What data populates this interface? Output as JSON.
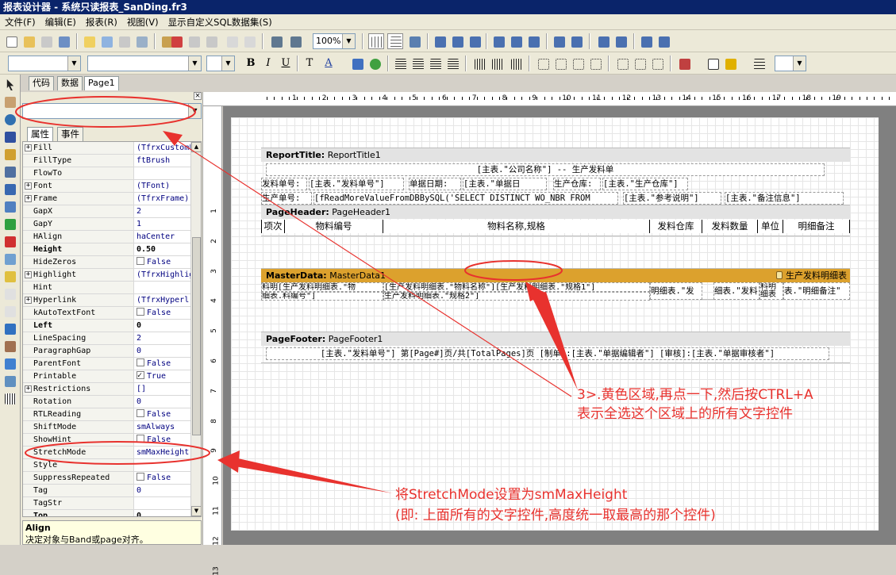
{
  "window": {
    "title": "报表设计器 - 系统只读报表_SanDing.fr3"
  },
  "menu": [
    "文件(F)",
    "编辑(E)",
    "报表(R)",
    "视图(V)",
    "显示自定义SQL数据集(S)"
  ],
  "toolbar": {
    "zoom": "100%"
  },
  "left_tabs": [
    "代码",
    "数据",
    "Page1"
  ],
  "inspector": {
    "object_combo": "",
    "tabs": [
      "属性",
      "事件"
    ],
    "properties": [
      {
        "name": "Fill",
        "value": "(TfrxCustomF",
        "expand": true
      },
      {
        "name": "FillType",
        "value": "ftBrush"
      },
      {
        "name": "FlowTo",
        "value": ""
      },
      {
        "name": "Font",
        "value": "(TFont)",
        "expand": true
      },
      {
        "name": "Frame",
        "value": "(TfrxFrame)",
        "expand": true
      },
      {
        "name": "GapX",
        "value": "2"
      },
      {
        "name": "GapY",
        "value": "1"
      },
      {
        "name": "HAlign",
        "value": "haCenter"
      },
      {
        "name": "Height",
        "value": "0.50",
        "bold": true
      },
      {
        "name": "HideZeros",
        "value": "False",
        "check": false
      },
      {
        "name": "Highlight",
        "value": "(TfrxHighlig",
        "expand": true
      },
      {
        "name": "Hint",
        "value": ""
      },
      {
        "name": "Hyperlink",
        "value": "(TfrxHyperl:",
        "expand": true
      },
      {
        "name": "kAutoTextFont",
        "value": "False",
        "check": false
      },
      {
        "name": "Left",
        "value": "0",
        "bold": true
      },
      {
        "name": "LineSpacing",
        "value": "2"
      },
      {
        "name": "ParagraphGap",
        "value": "0"
      },
      {
        "name": "ParentFont",
        "value": "False",
        "check": false
      },
      {
        "name": "Printable",
        "value": "True",
        "check": true
      },
      {
        "name": "Restrictions",
        "value": "[]",
        "expand": true
      },
      {
        "name": "Rotation",
        "value": "0"
      },
      {
        "name": "RTLReading",
        "value": "False",
        "check": false
      },
      {
        "name": "ShiftMode",
        "value": "smAlways"
      },
      {
        "name": "ShowHint",
        "value": "False",
        "check": false
      },
      {
        "name": "StretchMode",
        "value": "smMaxHeight"
      },
      {
        "name": "Style",
        "value": ""
      },
      {
        "name": "SuppressRepeated",
        "value": "False",
        "check": false
      },
      {
        "name": "Tag",
        "value": "0"
      },
      {
        "name": "TagStr",
        "value": ""
      },
      {
        "name": "Top",
        "value": "0",
        "bold": true
      }
    ],
    "help_title": "Align",
    "help_text": "决定对象与Band或page对齐。"
  },
  "ruler_h": [
    "1",
    "2",
    "3",
    "4",
    "5",
    "6",
    "7",
    "8",
    "9",
    "10",
    "11",
    "12",
    "13",
    "14",
    "15",
    "16",
    "17",
    "18",
    "19"
  ],
  "ruler_v": [
    "1",
    "2",
    "3",
    "4",
    "5",
    "6",
    "7",
    "8",
    "9",
    "10",
    "11",
    "12",
    "13"
  ],
  "bands": {
    "report_title": {
      "label": "ReportTitle:",
      "name": "ReportTitle1",
      "line1": "[主表.\"公司名称\"] -- 生产发料单",
      "line2": [
        "发料单号:",
        "[主表.\"发料单号\"]",
        "单据日期:",
        "[主表.\"单据日",
        "生产仓库:",
        "[主表.\"生产仓库\"]"
      ],
      "line3": [
        "生产单号:",
        "[fReadMoreValueFromDBBySQL('SELECT DISTINCT WO_NBR FROM",
        "[主表.\"参考说明\"]",
        "[主表.\"备注信息\"]"
      ]
    },
    "page_header": {
      "label": "PageHeader:",
      "name": "PageHeader1",
      "columns": [
        "项次",
        "物料编号",
        "物料名称,规格",
        "发料仓库",
        "发料数量",
        "单位",
        "明细备注"
      ]
    },
    "master_data": {
      "label": "MasterData:",
      "name": "MasterData1",
      "dataset": "生产发料明细表",
      "cells": [
        "料明[生产发料明细表.\"物",
        "[生产发料明细表.\"物料名称\"][生产发料明细表.\"规格1\"]",
        "明细表.\"发",
        "细表.\"发料",
        "料明细表",
        "表.\"明细备注\""
      ],
      "cells2": [
        "细表.料编号\"]",
        "生产发料明细表.\"规格2\"]"
      ]
    },
    "page_footer": {
      "label": "PageFooter:",
      "name": "PageFooter1",
      "line": "[主表.\"发料单号\"] 第[Page#]页/共[TotalPages]页 [制单]:[主表.\"单据编辑者\"] [审核]:[主表.\"单据审核者\"]"
    }
  },
  "annotations": {
    "a1_line1": "3>.黄色区域,再点一下,然后按CTRL+A",
    "a1_line2": "表示全选这个区域上的所有文字控件",
    "a2_line1": "将StretchMode设置为smMaxHeight",
    "a2_line2": "(即: 上面所有的文字控件,高度统一取最高的那个控件)"
  },
  "colors": {
    "annotation": "#e8322e",
    "master_band": "#dca12d",
    "titlebar": "#0a246a"
  }
}
